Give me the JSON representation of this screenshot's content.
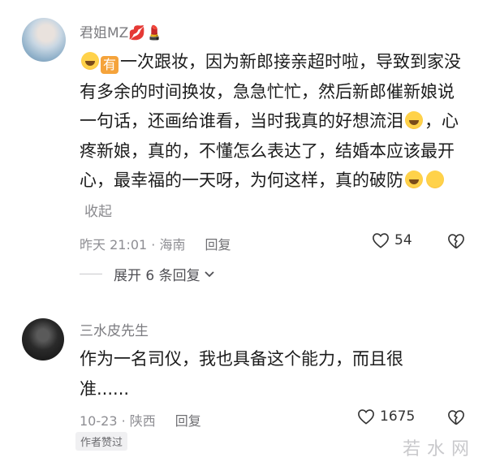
{
  "comments": [
    {
      "username": "君姐MZ💋💄",
      "text_parts": [
        "一次跟妆，因为新郎接亲超时啦，导致到家没有多余的时间换妆，急急忙忙，然后新郎催新娘说一句话，还画给谁看，当时我真的好想流泪",
        "，心疼新娘，真的，不懂怎么表达了，结婚本应该最开心，最幸福的一天呀，为何这样，真的破防"
      ],
      "emoji_box_char": "有",
      "collapse_label": "收起",
      "meta": "昨天 21:01 · 海南",
      "reply_label": "回复",
      "likes": "54",
      "expand_label": "展开 6 条回复"
    },
    {
      "username": "三水皮先生",
      "text": "作为一名司仪，我也具备这个能力，而且很准......",
      "meta": "10-23 · 陕西",
      "reply_label": "回复",
      "likes": "1675",
      "badge": "作者赞过"
    }
  ],
  "watermark": "若水网",
  "icons": {
    "like": "heart-outline-icon",
    "dislike": "broken-heart-icon",
    "expand_arrow": "chevron-down-icon"
  }
}
